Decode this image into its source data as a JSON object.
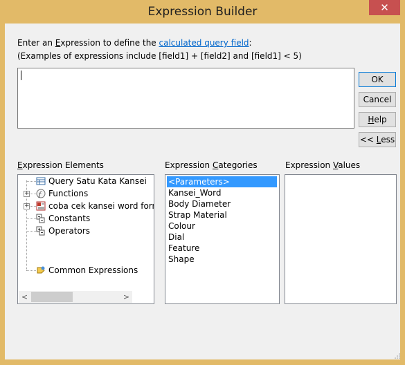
{
  "window": {
    "title": "Expression Builder",
    "close_glyph": "✕",
    "title_color": "#e2ba68",
    "close_color": "#c75050"
  },
  "instructions": {
    "line1_prefix": "Enter an ",
    "line1_underlined": "E",
    "line1_mid": "xpression to define the ",
    "line1_link": "calculated query field",
    "line1_suffix": ":",
    "line2": "(Examples of expressions include [field1] + [field2] and [field1] < 5)"
  },
  "expression": {
    "value": ""
  },
  "buttons": {
    "ok": "OK",
    "cancel": "Cancel",
    "help_u": "H",
    "help_rest": "elp",
    "less_prefix": "<< ",
    "less_u": "L",
    "less_rest": "ess"
  },
  "sections": {
    "elements_u": "E",
    "elements_rest": "xpression Elements",
    "categories_prefix": "Expression ",
    "categories_u": "C",
    "categories_rest": "ategories",
    "values_prefix": "Expression ",
    "values_u": "V",
    "values_rest": "alues"
  },
  "elements": [
    {
      "label": "Query Satu Kata Kansei",
      "icon": "query-icon",
      "expandable": false
    },
    {
      "label": "Functions",
      "icon": "functions-icon",
      "expandable": true
    },
    {
      "label": "coba cek kansei word form",
      "icon": "form-icon",
      "expandable": true
    },
    {
      "label": "Constants",
      "icon": "constants-icon",
      "expandable": false
    },
    {
      "label": "Operators",
      "icon": "operators-icon",
      "expandable": false
    },
    {
      "label": "Common Expressions",
      "icon": "common-expressions-icon",
      "expandable": false
    }
  ],
  "categories": [
    {
      "label": "<Parameters>",
      "selected": true
    },
    {
      "label": "Kansei_Word",
      "selected": false
    },
    {
      "label": "Body Diameter",
      "selected": false
    },
    {
      "label": "Strap Material",
      "selected": false
    },
    {
      "label": "Colour",
      "selected": false
    },
    {
      "label": "Dial",
      "selected": false
    },
    {
      "label": "Feature",
      "selected": false
    },
    {
      "label": "Shape",
      "selected": false
    }
  ],
  "scrollbar": {
    "left_arrow": "<",
    "right_arrow": ">"
  }
}
